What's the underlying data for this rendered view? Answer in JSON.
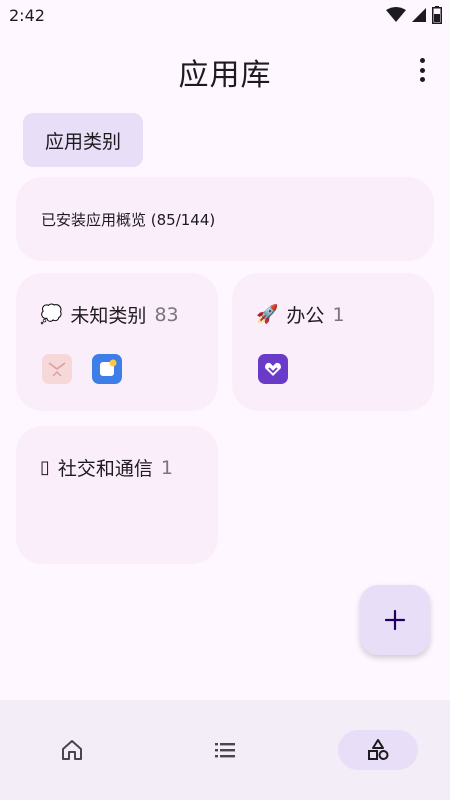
{
  "status_bar": {
    "time": "2:42",
    "icons": [
      "wifi-icon",
      "cell-signal-icon",
      "battery-icon"
    ]
  },
  "header": {
    "title": "应用库",
    "menu_icon": "more-vert-icon"
  },
  "chip": {
    "label": "应用类别"
  },
  "overview": {
    "text": "已安装应用概览 (85/144)"
  },
  "categories": [
    {
      "emoji": "💭",
      "name": "未知类别",
      "count": "83",
      "apps": [
        "pink-envelope-app-icon",
        "blue-note-app-icon"
      ]
    },
    {
      "emoji": "🚀",
      "name": "办公",
      "count": "1",
      "apps": [
        "purple-heart-app-icon"
      ]
    },
    {
      "emoji": "▯",
      "name": "社交和通信",
      "count": "1",
      "apps": []
    }
  ],
  "fab": {
    "icon": "plus-icon"
  },
  "bottom_nav": {
    "items": [
      {
        "icon": "home-icon",
        "active": false
      },
      {
        "icon": "list-icon",
        "active": false
      },
      {
        "icon": "shapes-icon",
        "active": true
      }
    ]
  },
  "colors": {
    "background": "#fef7ff",
    "card": "#fbeefb",
    "accent": "#e8def8",
    "nav_background": "#f3edf7",
    "text": "#1d1b20",
    "secondary_text": "#79747e"
  }
}
